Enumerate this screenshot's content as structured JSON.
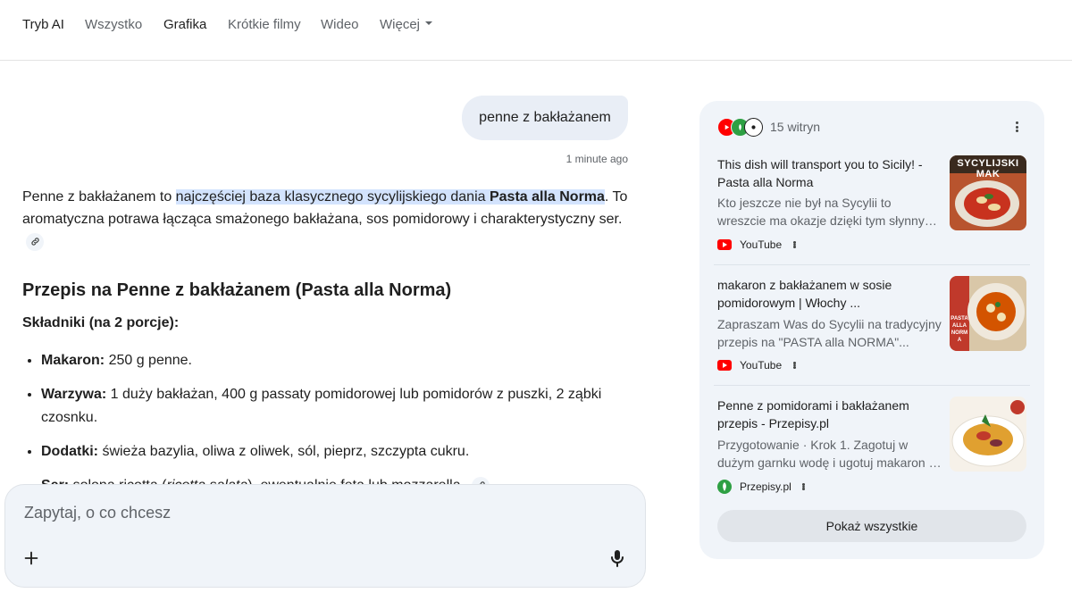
{
  "nav": {
    "tabs": [
      "Tryb AI",
      "Wszystko",
      "Grafika",
      "Krótkie filmy",
      "Wideo",
      "Więcej"
    ]
  },
  "chat": {
    "user_query": "penne z bakłażanem",
    "timestamp": "1 minute ago"
  },
  "answer": {
    "intro_plain": "Penne z bakłażanem to ",
    "intro_highlight": "najczęściej baza klasycznego sycylijskiego dania ",
    "intro_highlight_bold": "Pasta alla Norma",
    "intro_rest": ". To aromatyczna potrawa łącząca smażonego bakłażana, sos pomidorowy i charakterystyczny ser.",
    "recipe_title": "Przepis na Penne z bakłażanem (Pasta alla Norma)",
    "ingredients_heading": "Składniki (na 2 porcje):",
    "ingredients": [
      {
        "label": "Makaron:",
        "text": " 250 g penne."
      },
      {
        "label": "Warzywa:",
        "text": " 1 duży bakłażan, 400 g passaty pomidorowej lub pomidorów z puszki, 2 ząbki czosnku."
      },
      {
        "label": "Dodatki:",
        "text": " świeża bazylia, oliwa z oliwek, sól, pieprz, szczypta cukru."
      },
      {
        "label": "Ser:",
        "text_before": " solona ricotta (",
        "text_italic": "ricotta salata",
        "text_after": "), ewentualnie feta lub mozzarella."
      }
    ]
  },
  "prompt": {
    "placeholder": "Zapytaj, o co chcesz"
  },
  "sources": {
    "count_label": "15 witryn",
    "items": [
      {
        "title": "This dish will transport you to Sicily! - Pasta alla Norma",
        "snippet": "Kto jeszcze nie był na Sycylii to wreszcie ma okazje dzięki tym słynnym makaronie...",
        "source": "YouTube",
        "source_icon": "youtube-icon",
        "thumb_caption": "SYCYLIJSKI MAK"
      },
      {
        "title": "makaron z bakłażanem w sosie pomidorowym | Włochy ...",
        "snippet": "Zapraszam Was do Sycylii na tradycyjny przepis na \"PASTA alla NORMA\"...",
        "source": "YouTube",
        "source_icon": "youtube-icon",
        "thumb_caption": "PASTA ALLA NORMA"
      },
      {
        "title": "Penne z pomidorami i bakłażanem przepis - Przepisy.pl",
        "snippet": "Przygotowanie · Krok 1. Zagotuj w dużym garnku wodę i ugotuj makaron al dente...",
        "source": "Przepisy.pl",
        "source_icon": "przepisy-icon",
        "thumb_caption": ""
      }
    ],
    "show_all_label": "Pokaż wszystkie"
  },
  "colors": {
    "accent_bubble": "#e9eef6",
    "highlight": "#d3e3fd",
    "panel_bg": "#f0f4f9",
    "youtube_red": "#ff0000",
    "przepisy_green": "#2ea043"
  }
}
